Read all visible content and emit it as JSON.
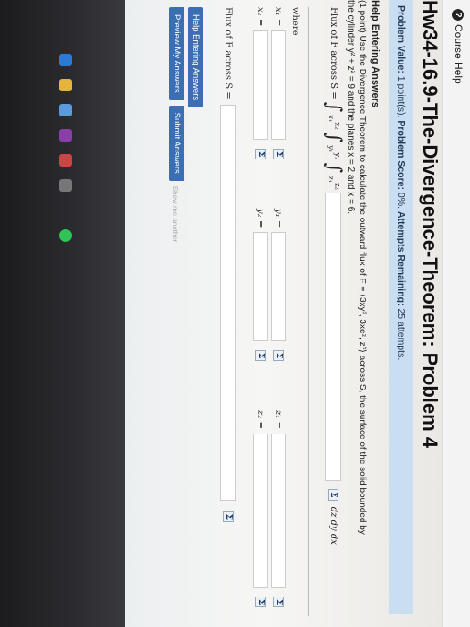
{
  "topbar": {
    "course_help": "Course Help"
  },
  "title": "Hw34-16.9-The-Divergence-Theorem: Problem 4",
  "info": {
    "problem_value_label": "Problem Value:",
    "problem_value": "1 point(s).",
    "problem_score_label": "Problem Score:",
    "problem_score": "0%.",
    "attempts_label": "Attempts Remaining:",
    "attempts": "25 attempts."
  },
  "problem": {
    "help_heading": "Help Entering Answers",
    "statement_1": "(1 point) Use the Divergence Theorem to calculate the outward flux of F = ⟨3xy², 3xeᶻ, z³⟩ across S, the surface of the solid bounded by",
    "statement_2": "the cylinder y² + z² = 9 and the planes x = 2 and x = 6."
  },
  "flux_integral": {
    "label": "Flux of F across S =",
    "integrand_suffix": "dz dy dx",
    "lim_x_lower": "x₁",
    "lim_x_upper": "x₂",
    "lim_y_lower": "y₁",
    "lim_y_upper": "y₂",
    "lim_z_lower": "z₁",
    "lim_z_upper": "z₂"
  },
  "where": {
    "label": "where",
    "x1": "x₁ =",
    "x2": "x₂ =",
    "y1": "y₁ =",
    "y2": "y₂ =",
    "z1": "z₁ =",
    "z2": "z₂ ="
  },
  "math_button": "Σ",
  "flux_answer_label": "Flux of F across S =",
  "buttons": {
    "help": "Help Entering Answers",
    "preview": "Preview My Answers",
    "submit": "Submit Answers",
    "show_tries": "Show me another"
  }
}
